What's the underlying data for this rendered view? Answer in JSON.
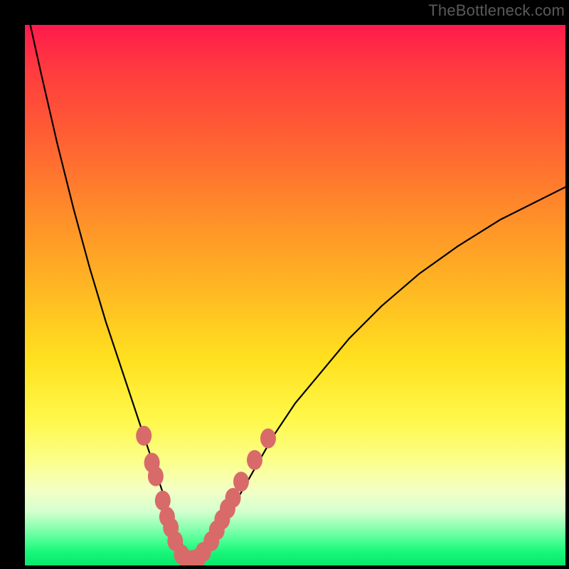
{
  "watermark": "TheBottleneck.com",
  "chart_data": {
    "type": "line",
    "title": "",
    "xlabel": "",
    "ylabel": "",
    "xlim": [
      0,
      100
    ],
    "ylim": [
      0,
      100
    ],
    "grid": false,
    "legend": false,
    "series": [
      {
        "name": "bottleneck-curve",
        "x": [
          1,
          3,
          6,
          9,
          12,
          15,
          18,
          20,
          22,
          24,
          25,
          26,
          27,
          28,
          29,
          30,
          31,
          32,
          33,
          35,
          38,
          42,
          46,
          50,
          55,
          60,
          66,
          73,
          80,
          88,
          96,
          100
        ],
        "y": [
          100,
          91,
          78,
          66,
          55,
          45,
          36,
          30,
          24,
          18,
          15,
          12,
          9,
          6,
          4,
          2,
          1,
          1,
          2,
          5,
          10,
          17,
          24,
          30,
          36,
          42,
          48,
          54,
          59,
          64,
          68,
          70
        ]
      }
    ],
    "markers": {
      "name": "highlight-dots",
      "color": "#d96a6a",
      "points": [
        {
          "x": 22.0,
          "y": 24.0
        },
        {
          "x": 23.5,
          "y": 19.0
        },
        {
          "x": 24.2,
          "y": 16.5
        },
        {
          "x": 25.5,
          "y": 12.0
        },
        {
          "x": 26.3,
          "y": 9.0
        },
        {
          "x": 27.0,
          "y": 7.0
        },
        {
          "x": 27.8,
          "y": 4.5
        },
        {
          "x": 29.0,
          "y": 2.0
        },
        {
          "x": 30.0,
          "y": 1.0
        },
        {
          "x": 31.0,
          "y": 1.0
        },
        {
          "x": 32.0,
          "y": 1.3
        },
        {
          "x": 33.0,
          "y": 2.5
        },
        {
          "x": 34.5,
          "y": 4.5
        },
        {
          "x": 35.5,
          "y": 6.5
        },
        {
          "x": 36.5,
          "y": 8.5
        },
        {
          "x": 37.5,
          "y": 10.5
        },
        {
          "x": 38.5,
          "y": 12.5
        },
        {
          "x": 40.0,
          "y": 15.5
        },
        {
          "x": 42.5,
          "y": 19.5
        },
        {
          "x": 45.0,
          "y": 23.5
        }
      ]
    },
    "gradient_stops": [
      {
        "pct": 0,
        "color": "#ff1a4d"
      },
      {
        "pct": 20,
        "color": "#ff5d34"
      },
      {
        "pct": 48,
        "color": "#ffb523"
      },
      {
        "pct": 73,
        "color": "#fff84a"
      },
      {
        "pct": 90,
        "color": "#d4ffcf"
      },
      {
        "pct": 100,
        "color": "#0ae86c"
      }
    ]
  }
}
